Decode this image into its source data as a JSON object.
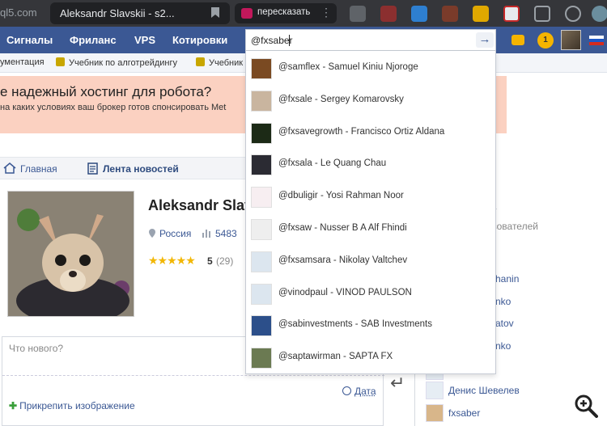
{
  "browser": {
    "url_fragment": "ql5.com",
    "tab_title": "Aleksandr Slavskii - s2...",
    "extension_pill_label": "пересказать"
  },
  "navbar": {
    "items": [
      "Сигналы",
      "Фриланс",
      "VPS",
      "Котировки"
    ],
    "notification_count": "1"
  },
  "bookmarks": [
    "ументация",
    "Учебник по алготрейдингу",
    "Учебник"
  ],
  "ad": {
    "title": "е надежный хостинг для робота?",
    "subtitle": "на каких условиях ваш брокер готов спонсировать Met"
  },
  "breadcrumb": {
    "home": "Главная",
    "current": "Лента новостей"
  },
  "profile": {
    "name": "Aleksandr Slav",
    "country": "Россия",
    "count": "5483",
    "stars": "★★★★★",
    "rating": "5",
    "reviews": "(29)"
  },
  "composer": {
    "placeholder": "Что нового?",
    "attach_label": "Прикрепить изображение",
    "date_label": "Дата"
  },
  "right_column": {
    "header": "ьзователей",
    "items": [
      "hanin",
      "nko",
      "atov",
      "nko",
      "Денис Шевелев",
      "fxsaber"
    ]
  },
  "search": {
    "query": "@fxsaber",
    "suggestions": [
      {
        "text": "@samflex - Samuel Kiniu Njoroge",
        "avatar": "#7a4a22"
      },
      {
        "text": "@fxsale - Sergey Komarovsky",
        "avatar": "#c9b59f"
      },
      {
        "text": "@fxsavegrowth - Francisco Ortiz Aldana",
        "avatar": "#1c2a16"
      },
      {
        "text": "@fxsala - Le Quang Chau",
        "avatar": "#2b2b33"
      },
      {
        "text": "@dbuligir - Yosi Rahman Noor",
        "avatar": "#f7eef1"
      },
      {
        "text": "@fxsaw - Nusser B A Alf Fhindi",
        "avatar": "#eeeeee"
      },
      {
        "text": "@fxsamsara - Nikolay Valtchev",
        "avatar": "#dce6ef"
      },
      {
        "text": "@vinodpaul - VINOD PAULSON",
        "avatar": "#dce6ef"
      },
      {
        "text": "@sabinvestments - SAB Investments",
        "avatar": "#2c4f8a"
      },
      {
        "text": "@saptawirman - SAPTA FX",
        "avatar": "#6b7a52"
      }
    ]
  },
  "colors": {
    "navbar": "#3b5894",
    "link": "#3b5894",
    "ad_background": "#fbd1c1",
    "browser_chrome": "#35363a"
  }
}
